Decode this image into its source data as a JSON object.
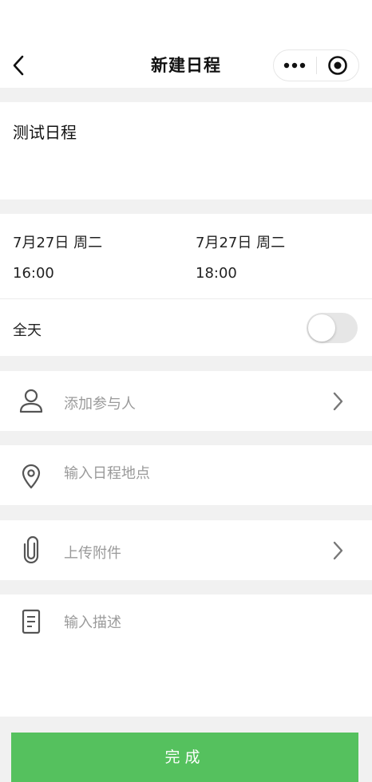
{
  "nav": {
    "title": "新建日程",
    "back_icon": "chevron-left-icon",
    "more_icon": "more-dots-icon",
    "close_icon": "target-circle-icon"
  },
  "event": {
    "title": "测试日程"
  },
  "time": {
    "start_date": "7月27日 周二",
    "start_time": "16:00",
    "end_date": "7月27日 周二",
    "end_time": "18:00"
  },
  "allday": {
    "label": "全天",
    "enabled": false
  },
  "rows": {
    "attendees_placeholder": "添加参与人",
    "location_placeholder": "输入日程地点",
    "attachment_placeholder": "上传附件",
    "description_placeholder": "输入描述"
  },
  "footer": {
    "done_label": "完成"
  },
  "colors": {
    "accent": "#55c15e",
    "background": "#f1f1f1",
    "placeholder": "#9a9a9a"
  }
}
